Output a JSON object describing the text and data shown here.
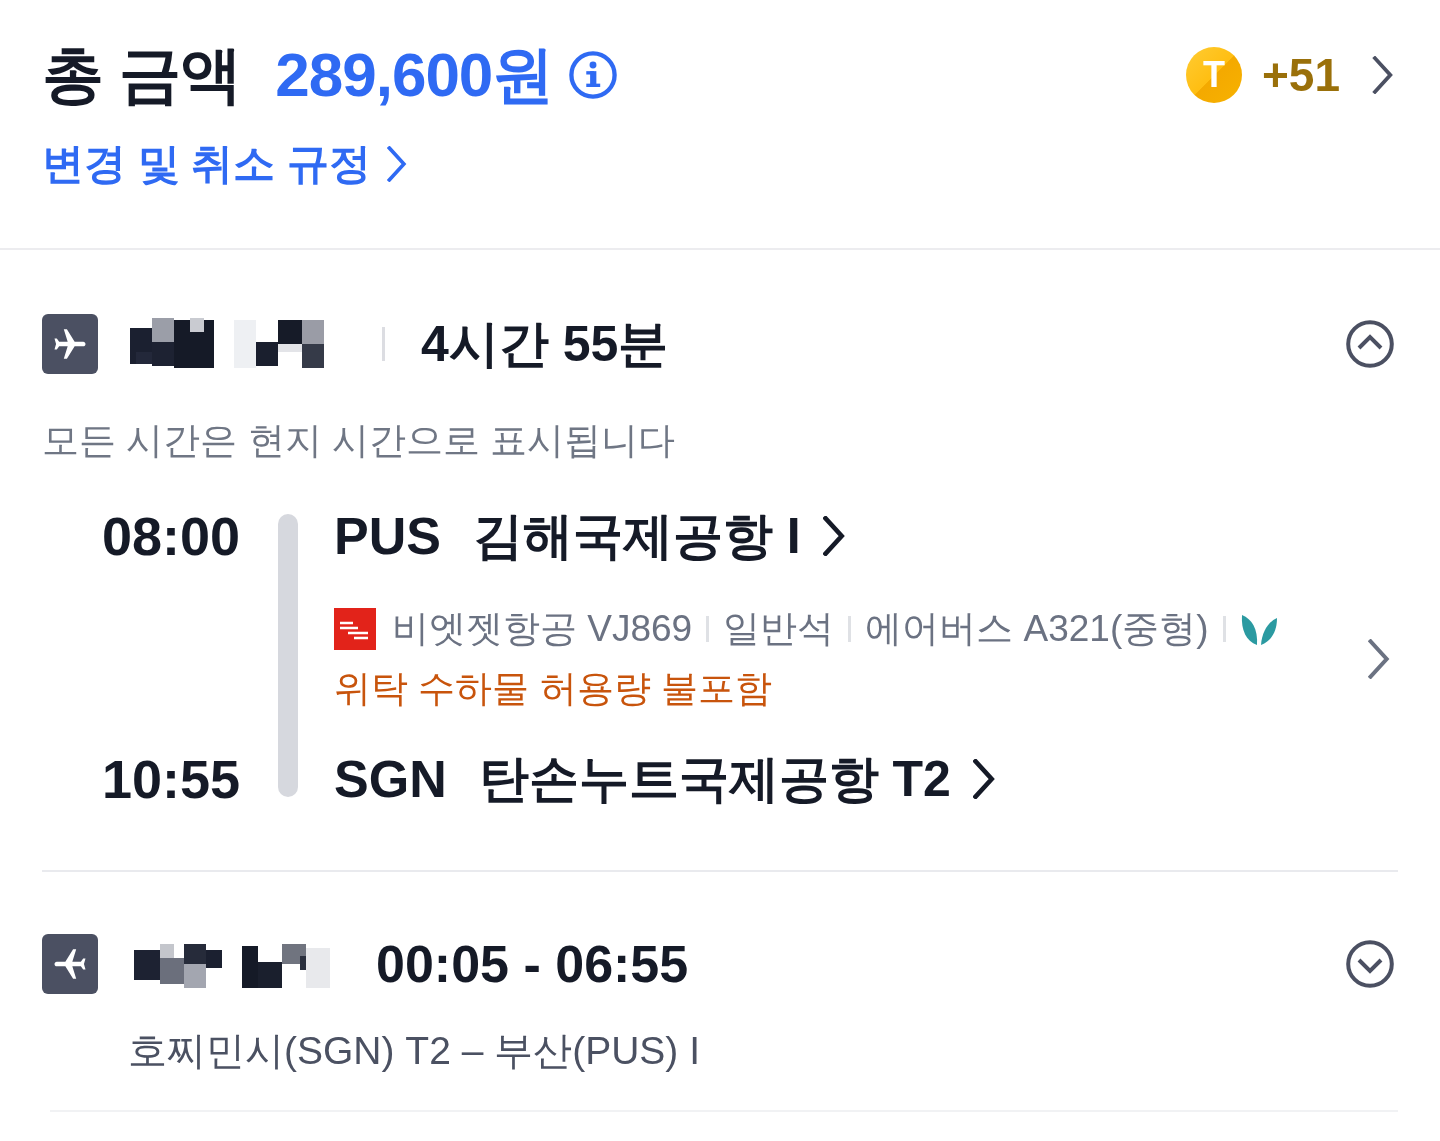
{
  "summary": {
    "total_label": "총 금액",
    "total_amount": "289,600원",
    "points_symbol": "T",
    "points": "+51",
    "policy_link": "변경 및 취소 규정"
  },
  "flights": [
    {
      "kind": "outbound",
      "expanded": true,
      "duration": "4시간 55분",
      "note": "모든 시간은 현지 시간으로 표시됩니다",
      "departure": {
        "time": "08:00",
        "code": "PUS",
        "airport": "김해국제공항 I"
      },
      "segment": {
        "airline": "비엣젯항공 VJ869",
        "cabin": "일반석",
        "aircraft": "에어버스 A321(중형)",
        "baggage": "위탁 수하물 허용량 불포함"
      },
      "arrival": {
        "time": "10:55",
        "code": "SGN",
        "airport": "탄손누트국제공항 T2"
      }
    },
    {
      "kind": "return",
      "expanded": false,
      "times": "00:05 - 06:55",
      "route": "호찌민시(SGN) T2 – 부산(PUS) I"
    }
  ]
}
